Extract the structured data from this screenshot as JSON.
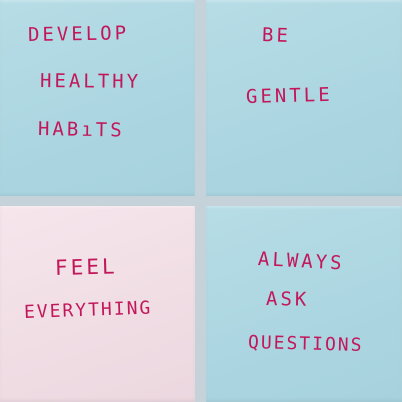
{
  "notes": {
    "top_left": {
      "color": "#b0d8e2",
      "lines": [
        "DEVELOP",
        "HEALTHY",
        "HABıTS"
      ]
    },
    "top_right": {
      "color": "#b0d8e2",
      "lines": [
        "BE",
        "GENTLE"
      ]
    },
    "bottom_left": {
      "color": "#f3e1e8",
      "lines": [
        "FEEL",
        "EVERYTHING"
      ]
    },
    "bottom_right": {
      "color": "#b0d8e2",
      "lines": [
        "ALWAYS",
        "ASK",
        "QUESTIONS"
      ]
    }
  },
  "ink_color": "#c2185b"
}
